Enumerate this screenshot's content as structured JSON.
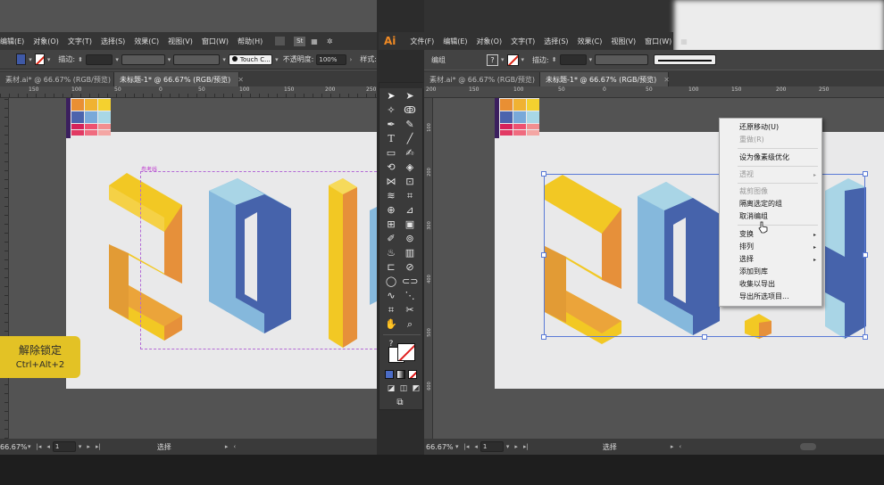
{
  "left": {
    "menu": [
      "编辑(E)",
      "对象(O)",
      "文字(T)",
      "选择(S)",
      "效果(C)",
      "视图(V)",
      "窗口(W)",
      "帮助(H)"
    ],
    "menu_icons": [
      "St"
    ],
    "ctrl": {
      "stroke_label": "描边:",
      "brush_value": "Touch C...",
      "opacity_label": "不透明度:",
      "opacity_value": "100%",
      "style_label": "样式:"
    },
    "tabs": [
      {
        "label": "素材.ai* @ 66.67% (RGB/预览)"
      },
      {
        "label": "未标题-1* @ 66.67% (RGB/预览)"
      }
    ],
    "ruler": [
      "150",
      "100",
      "50",
      "0",
      "50",
      "100",
      "150",
      "200",
      "250"
    ],
    "guide_label": "参考线",
    "status": {
      "zoom": "66.67%",
      "page": "1",
      "tool": "选择"
    }
  },
  "right": {
    "app_logo": "Ai",
    "menu": [
      "文件(F)",
      "编辑(E)",
      "对象(O)",
      "文字(T)",
      "选择(S)",
      "效果(C)",
      "视图(V)",
      "窗口(W)"
    ],
    "ctrl": {
      "group_label": "编组",
      "stroke_label": "描边:"
    },
    "tabs": [
      {
        "label": "素材.ai* @ 66.67% (RGB/预览)"
      },
      {
        "label": "未标题-1* @ 66.67% (RGB/预览)"
      }
    ],
    "ruler": [
      "200",
      "150",
      "100",
      "50",
      "0",
      "50",
      "100",
      "150",
      "200",
      "250"
    ],
    "status": {
      "zoom": "66.67%",
      "page": "1",
      "tool": "选择"
    }
  },
  "vruler": [
    "100",
    "150",
    "200",
    "250",
    "300",
    "350",
    "400",
    "450",
    "500",
    "550",
    "600",
    "650",
    "700"
  ],
  "context_menu": {
    "items": [
      {
        "label": "还原移动(U)",
        "disabled": false
      },
      {
        "label": "重做(R)",
        "disabled": true
      },
      {
        "label": "设为像素级优化",
        "disabled": false
      },
      {
        "label": "透视",
        "disabled": true,
        "submenu": true
      },
      {
        "label": "裁剪图像",
        "disabled": true
      },
      {
        "label": "隔离选定的组",
        "disabled": false
      },
      {
        "label": "取消编组",
        "disabled": false
      },
      {
        "label": "变换",
        "disabled": false,
        "submenu": true
      },
      {
        "label": "排列",
        "disabled": false,
        "submenu": true
      },
      {
        "label": "选择",
        "disabled": false,
        "submenu": true
      },
      {
        "label": "添加到库",
        "disabled": false
      },
      {
        "label": "收集以导出",
        "disabled": false
      },
      {
        "label": "导出所选项目...",
        "disabled": false
      }
    ]
  },
  "badge": {
    "title": "解除锁定",
    "shortcut": "Ctrl+Alt+2"
  },
  "colors": {
    "yellow": "#f2c824",
    "yellow_dark": "#e29b35",
    "orange": "#e6903a",
    "light_blue": "#a9d5e6",
    "mid_blue": "#85b8dc",
    "dark_blue": "#4663ab",
    "swatch_grid": [
      "#e98f33",
      "#f0b232",
      "#f4d12f",
      "#4c64ad",
      "#79a9d9",
      "#a8d7e6",
      "#d6225a",
      "#ee5070",
      "#f28f90"
    ]
  }
}
